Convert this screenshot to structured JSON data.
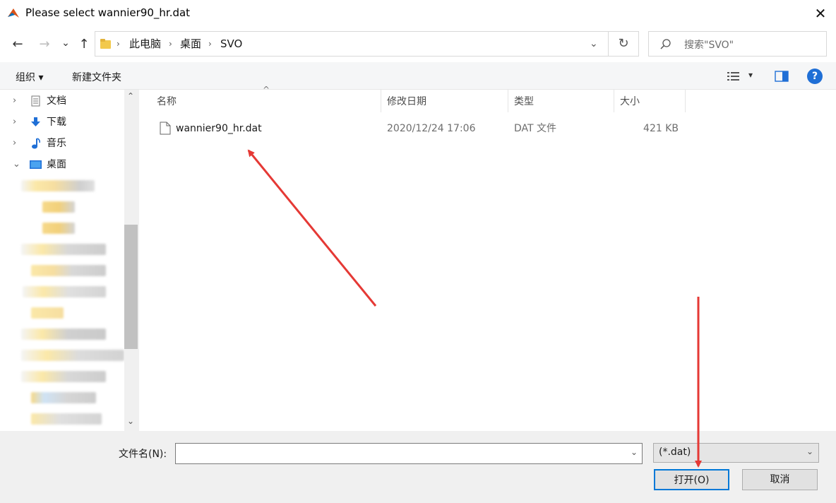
{
  "window": {
    "title": "Please select wannier90_hr.dat",
    "close_glyph": "✕",
    "app_icon": "matlab-icon"
  },
  "nav": {
    "back_glyph": "←",
    "forward_glyph": "→",
    "recent_glyph": "⌄",
    "up_glyph": "↑",
    "breadcrumb": [
      "此电脑",
      "桌面",
      "SVO"
    ],
    "crumb_sep": "›",
    "dropdown_glyph": "⌄",
    "refresh_glyph": "↻",
    "search_placeholder": "搜索\"SVO\""
  },
  "toolbar": {
    "organize_label": "组织 ▾",
    "new_folder_label": "新建文件夹",
    "view_dropdown_glyph": "▾",
    "help_glyph": "?"
  },
  "tree": [
    {
      "label": "文档",
      "arrow": "›",
      "icon": "documents-icon"
    },
    {
      "label": "下载",
      "arrow": "›",
      "icon": "downloads-icon"
    },
    {
      "label": "音乐",
      "arrow": "›",
      "icon": "music-icon"
    },
    {
      "label": "桌面",
      "arrow": "⌄",
      "icon": "desktop-icon"
    }
  ],
  "scroll": {
    "up_glyph": "⌃",
    "down_glyph": "⌄"
  },
  "columns": {
    "name": "名称",
    "modified": "修改日期",
    "type": "类型",
    "size": "大小",
    "sort_glyph": "^"
  },
  "files": [
    {
      "name": "wannier90_hr.dat",
      "modified": "2020/12/24 17:06",
      "type": "DAT 文件",
      "size": "421 KB"
    }
  ],
  "footer": {
    "filename_label": "文件名(N):",
    "filename_value": "",
    "filter_value": "(*.dat)",
    "filter_glyph": "⌄",
    "open_label": "打开(O)",
    "cancel_label": "取消"
  },
  "annotation_color": "#e53935"
}
